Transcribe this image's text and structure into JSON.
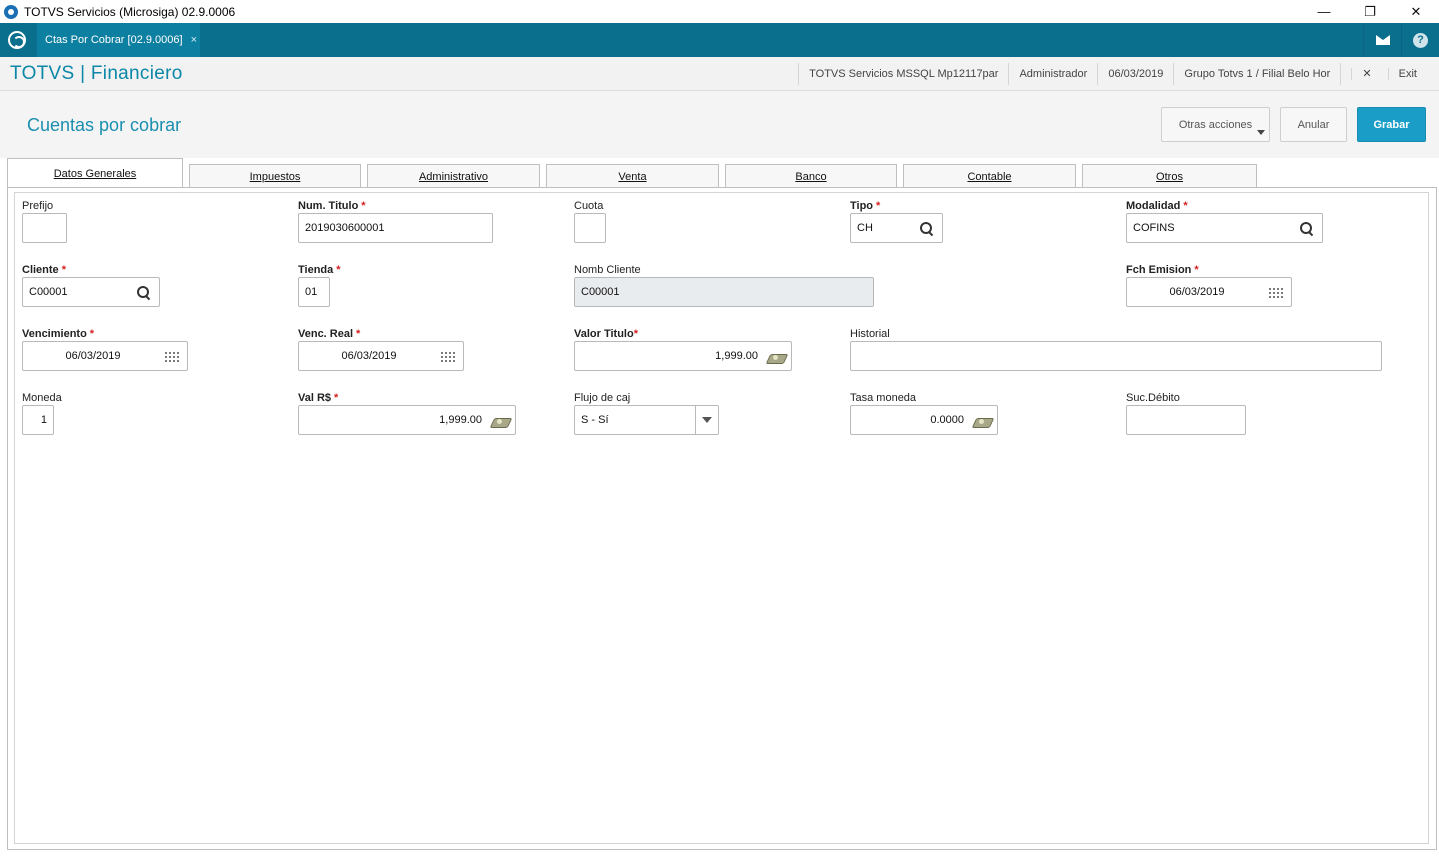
{
  "window": {
    "title": "TOTVS Servicios (Microsiga) 02.9.0006",
    "controls": [
      "—",
      "❐",
      "✕"
    ]
  },
  "apptab": {
    "label": "Ctas Por Cobrar [02.9.0006]",
    "close": "×"
  },
  "header": {
    "brand": "TOTVS | Financiero",
    "env": "TOTVS Servicios MSSQL Mp12117par",
    "user": "Administrador",
    "date": "06/03/2019",
    "branch": "Grupo Totvs 1 / Filial Belo Hor",
    "exit": "Exit",
    "exit_icon": "✕"
  },
  "page": {
    "title": "Cuentas por cobrar"
  },
  "actions": {
    "otras": "Otras acciones",
    "anular": "Anular",
    "grabar": "Grabar"
  },
  "tabs": [
    "Datos Generales",
    "Impuestos",
    "Administrativo",
    "Venta",
    "Banco",
    "Contable",
    "Otros"
  ],
  "fields": {
    "prefijo": {
      "label": "Prefijo",
      "value": ""
    },
    "num_titulo": {
      "label": "Num. Titulo",
      "value": "2019030600001"
    },
    "cuota": {
      "label": "Cuota",
      "value": ""
    },
    "tipo": {
      "label": "Tipo",
      "value": "CH"
    },
    "modalidad": {
      "label": "Modalidad",
      "value": "COFINS"
    },
    "cliente": {
      "label": "Cliente",
      "value": "C00001"
    },
    "tienda": {
      "label": "Tienda",
      "value": "01"
    },
    "nomb_cliente": {
      "label": "Nomb Cliente",
      "value": "C00001"
    },
    "fch_emision": {
      "label": "Fch Emision",
      "value": "06/03/2019"
    },
    "vencimiento": {
      "label": "Vencimiento",
      "value": "06/03/2019"
    },
    "venc_real": {
      "label": "Venc. Real",
      "value": "06/03/2019"
    },
    "valor_titulo": {
      "label": "Valor Titulo",
      "value": "1,999.00"
    },
    "historial": {
      "label": "Historial",
      "value": ""
    },
    "moneda": {
      "label": "Moneda",
      "value": "1"
    },
    "val_rs": {
      "label": "Val R$",
      "value": "1,999.00"
    },
    "flujo": {
      "label": "Flujo de caj",
      "value": "S - Sí"
    },
    "tasa": {
      "label": "Tasa moneda",
      "value": "0.0000"
    },
    "suc_debito": {
      "label": "Suc.Débito",
      "value": ""
    }
  },
  "required_mark": "*",
  "colors": {
    "topbar": "#0a6f8c",
    "brand": "#0b87a8",
    "primary_button": "#1a9ec8",
    "required": "#d21f1f"
  }
}
